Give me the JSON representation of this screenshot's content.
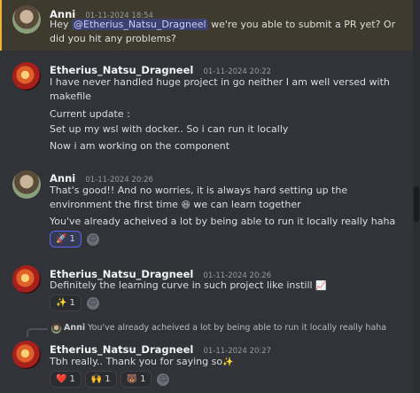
{
  "messages": [
    {
      "author": "Anni",
      "time": "01-11-2024 18:54",
      "lines": [
        "Hey ",
        "@Etherius_Natsu_Dragneel",
        " we're you able to submit a PR yet? Or",
        "did you hit any problems?"
      ]
    },
    {
      "author": "Etherius_Natsu_Dragneel",
      "time": "01-11-2024 20:22",
      "lines": [
        "I have never handled huge project in go neither I am well versed with",
        "makefile",
        "Current update :",
        "Set up my wsl with docker.. So i can run it locally",
        "Now i am working on the component"
      ]
    },
    {
      "author": "Anni",
      "time": "01-11-2024 20:26",
      "lines": [
        "That's good!! And no worries, it is always hard setting up the",
        "environment the first time",
        " we can learn together",
        "You've already acheived a lot by being able to run it locally really haha"
      ],
      "emoji_inline": "😆",
      "reactions": [
        {
          "emoji": "🚀",
          "count": "1"
        }
      ]
    },
    {
      "author": "Etherius_Natsu_Dragneel",
      "time": "01-11-2024 20:26",
      "lines": [
        "Definitely the learning curve in such project like instill "
      ],
      "emoji_inline": "📈",
      "reactions": [
        {
          "emoji": "✨",
          "count": "1"
        }
      ]
    },
    {
      "reply_author": "Anni",
      "reply_text": "You've already acheived a lot by being able to run it locally really haha",
      "author": "Etherius_Natsu_Dragneel",
      "time": "01-11-2024 20:27",
      "lines": [
        "Tbh really.. Thank you for saying so"
      ],
      "emoji_inline": "✨",
      "reactions": [
        {
          "emoji": "❤️",
          "count": "1"
        },
        {
          "emoji": "🙌",
          "count": "1"
        },
        {
          "emoji": "🐻",
          "count": "1"
        }
      ]
    }
  ],
  "add_reaction_icon": "☺"
}
